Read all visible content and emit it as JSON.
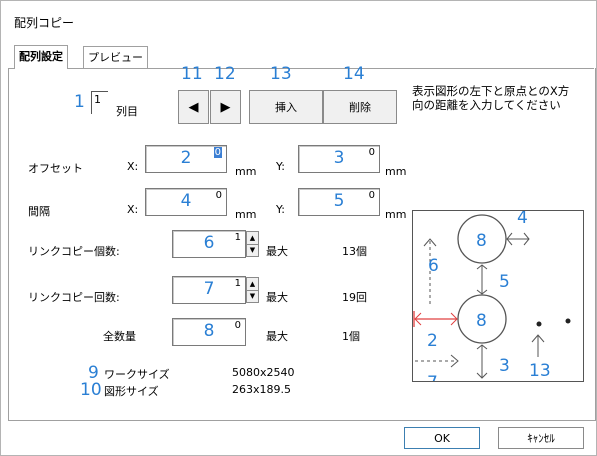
{
  "window": {
    "title": "配列コピー"
  },
  "tabs": [
    {
      "label": "配列設定",
      "active": true
    },
    {
      "label": "プレビュー",
      "active": false
    }
  ],
  "annotations": {
    "n1": "1",
    "n11": "11",
    "n12": "12",
    "n13": "13",
    "n14": "14",
    "n9": "9",
    "n10": "10"
  },
  "column": {
    "value": "1",
    "suffix": "列目"
  },
  "nav": {
    "prev_glyph": "◀",
    "next_glyph": "▶"
  },
  "actions": {
    "insert": "挿入",
    "delete": "削除"
  },
  "hint": {
    "line1": "表示図形の左下と原点とのX方",
    "line2": "向の距離を入力してください"
  },
  "offset": {
    "label": "オフセット",
    "x_label": "X:",
    "y_label": "Y:",
    "x_value": "0",
    "y_value": "0",
    "x_marker": "2",
    "y_marker": "3",
    "unit": "mm"
  },
  "spacing": {
    "label": "間隔",
    "x_label": "X:",
    "y_label": "Y:",
    "x_value": "0",
    "y_value": "0",
    "x_marker": "4",
    "y_marker": "5",
    "unit": "mm"
  },
  "link_count": {
    "label": "リンクコピー個数:",
    "value": "1",
    "marker": "6",
    "max_label": "最大",
    "max_value": "13個"
  },
  "link_times": {
    "label": "リンクコピー回数:",
    "value": "1",
    "marker": "7",
    "max_label": "最大",
    "max_value": "19回"
  },
  "total": {
    "label": "全数量",
    "value": "0",
    "marker": "8",
    "max_label": "最大",
    "max_value": "1個"
  },
  "work_size": {
    "label": "ワークサイズ",
    "value": "5080x2540"
  },
  "shape_size": {
    "label": "図形サイズ",
    "value": "263x189.5"
  },
  "preview": {
    "labels": {
      "c_top": "8",
      "c_bottom": "8",
      "p4": "4",
      "p6": "6",
      "p5": "5",
      "p2": "2",
      "p3": "3",
      "p7": "7",
      "p13": "13"
    },
    "accent_red": "#e04040",
    "accent_blue": "#2a7fd4"
  },
  "footer": {
    "ok": "OK",
    "cancel": "ｷｬﾝｾﾙ"
  }
}
